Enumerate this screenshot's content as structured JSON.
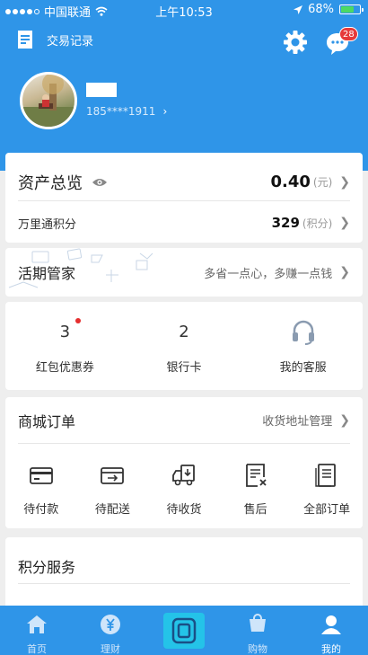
{
  "status_bar": {
    "carrier": "中国联通",
    "time": "上午10:53",
    "battery": "68%",
    "battery_level": 0.68
  },
  "header": {
    "record_label": "交易记录",
    "message_badge": "28",
    "phone": "185****1911",
    "icons": [
      "record-icon",
      "gear-icon",
      "message-icon"
    ]
  },
  "assets": {
    "title": "资产总览",
    "value": "0.40",
    "unit": "(元)",
    "points_label": "万里通积分",
    "points_value": "329",
    "points_unit": "(积分)"
  },
  "huoqi": {
    "title": "活期管家",
    "slogan": "多省一点心，多赚一点钱"
  },
  "quick": {
    "items": [
      {
        "value": "3",
        "label": "红包优惠券"
      },
      {
        "value": "2",
        "label": "银行卡"
      },
      {
        "label": "我的客服",
        "icon": "headset-icon"
      }
    ]
  },
  "orders": {
    "title": "商城订单",
    "address_link": "收货地址管理",
    "items": [
      {
        "label": "待付款",
        "icon": "wallet-card-icon"
      },
      {
        "label": "待配送",
        "icon": "box-arrow-icon"
      },
      {
        "label": "待收货",
        "icon": "truck-icon"
      },
      {
        "label": "售后",
        "icon": "receipt-x-icon"
      },
      {
        "label": "全部订单",
        "icon": "order-list-icon"
      }
    ]
  },
  "points_service": {
    "title": "积分服务"
  },
  "tabbar": {
    "items": [
      {
        "label": "首页",
        "icon": "home-icon"
      },
      {
        "label": "理财",
        "icon": "yuan-icon"
      },
      {
        "label": "",
        "icon": "center-logo-icon"
      },
      {
        "label": "购物",
        "icon": "cart-icon"
      },
      {
        "label": "我的",
        "icon": "profile-icon"
      }
    ]
  },
  "colors": {
    "primary": "#2f95e8",
    "center_tab": "#24c3e8",
    "badge": "#e63a3a"
  }
}
